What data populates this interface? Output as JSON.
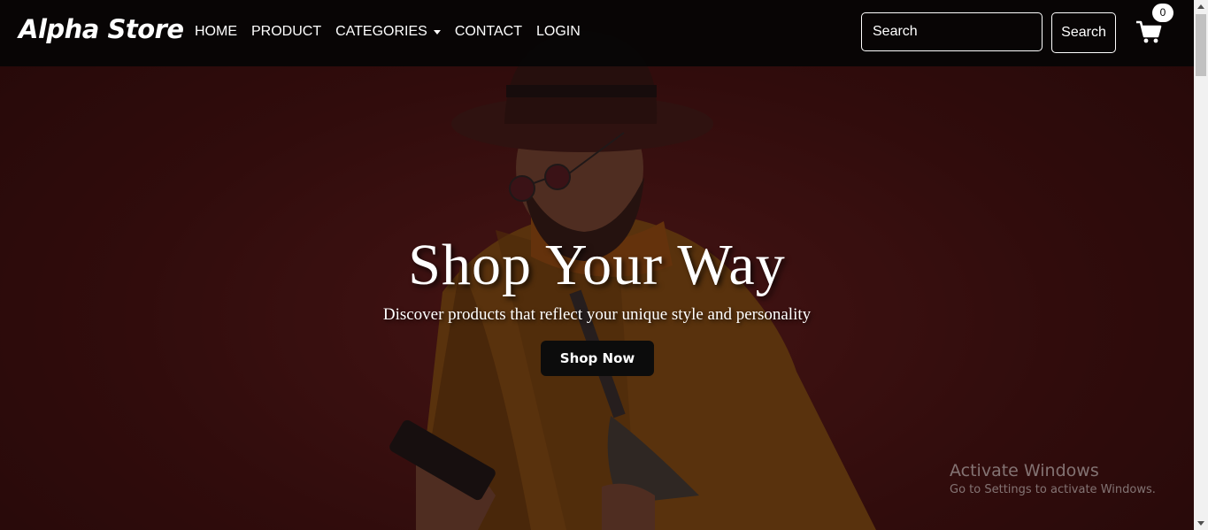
{
  "navbar": {
    "brand": "Alpha Store",
    "links": [
      "HOME",
      "PRODUCT",
      "CATEGORIES",
      "CONTACT",
      "LOGIN"
    ],
    "search_placeholder": "Search",
    "search_button": "Search",
    "cart_count": "0",
    "cart_icon": "cart-icon"
  },
  "hero": {
    "title": "Shop Your Way",
    "subtitle": "Discover products that reflect your unique style and personality",
    "cta": "Shop Now"
  },
  "watermark": {
    "title": "Activate Windows",
    "subtitle": "Go to Settings to activate Windows."
  },
  "colors": {
    "navbar_bg": "#050505",
    "hero_bg": "#3c1010",
    "cta_bg": "#0c0c0c",
    "text": "#ffffff"
  }
}
